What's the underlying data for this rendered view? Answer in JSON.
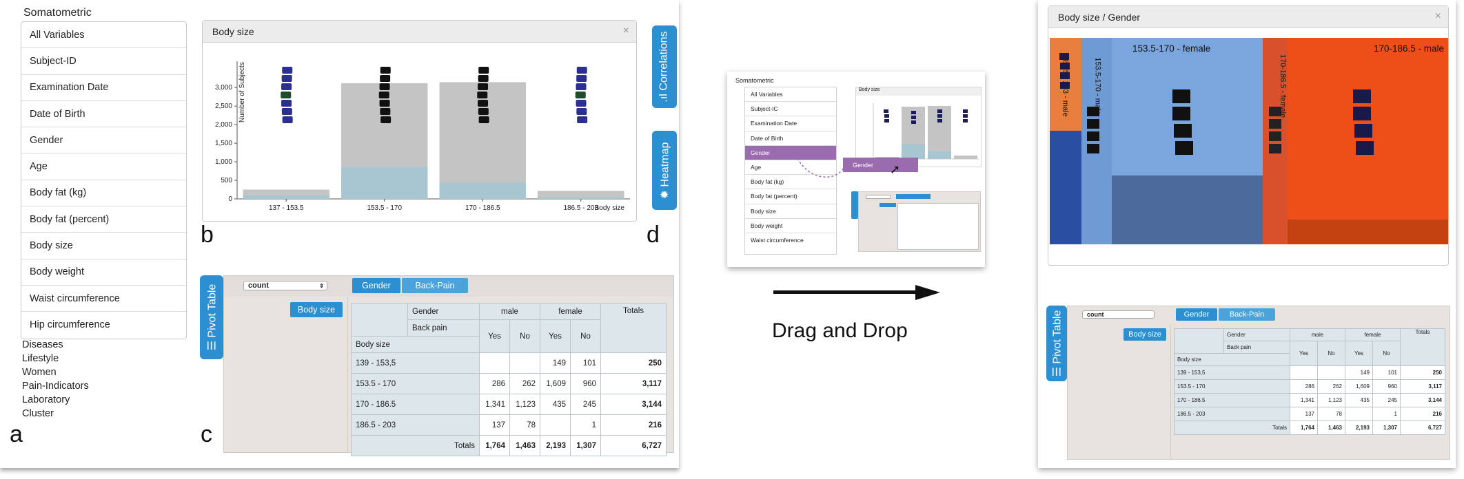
{
  "sidebar": {
    "title": "Somatometric",
    "items": [
      "All Variables",
      "Subject-ID",
      "Examination Date",
      "Date of Birth",
      "Gender",
      "Age",
      "Body fat (kg)",
      "Body fat (percent)",
      "Body size",
      "Body weight",
      "Waist circumference",
      "Hip circumference"
    ],
    "categories": [
      "Diseases",
      "Lifestyle",
      "Women",
      "Pain-Indicators",
      "Laboratory",
      "Cluster"
    ]
  },
  "letters": {
    "a": "a",
    "b": "b",
    "c": "c",
    "d": "d"
  },
  "chart_panel": {
    "title": "Body size",
    "close": "×"
  },
  "chart_data": {
    "type": "bar",
    "title": "Body size",
    "xlabel": "Body size",
    "ylabel": "Number of Subjects",
    "categories": [
      "137 - 153.5",
      "153.5 - 170",
      "170 - 186.5",
      "186.5 - 203"
    ],
    "values": [
      250,
      3117,
      3144,
      216
    ],
    "highlight_values": [
      100,
      860,
      440,
      40
    ],
    "yticks": [
      "0",
      "500",
      "1,000",
      "1,500",
      "2,000",
      "2,500",
      "3,000"
    ],
    "ylim": [
      0,
      3300
    ]
  },
  "side_tabs": {
    "correlations": "Correlations",
    "heatmap": "Heatmap",
    "pivot": "Pivot Table"
  },
  "pivot": {
    "select_value": "count",
    "column_vars": [
      "Gender",
      "Back-Pain"
    ],
    "row_var": "Body size",
    "header_gender": "Gender",
    "header_backpain": "Back pain",
    "male": "male",
    "female": "female",
    "totals_label": "Totals",
    "yes": "Yes",
    "no": "No",
    "body_size_label": "Body size",
    "rows": [
      {
        "label": "139 - 153,5",
        "cells": [
          "",
          "",
          "149",
          "101"
        ],
        "total": "250"
      },
      {
        "label": "153.5 - 170",
        "cells": [
          "286",
          "262",
          "1,609",
          "960"
        ],
        "total": "3,117"
      },
      {
        "label": "170 - 186.5",
        "cells": [
          "1,341",
          "1,123",
          "435",
          "245"
        ],
        "total": "3,144"
      },
      {
        "label": "186.5 - 203",
        "cells": [
          "137",
          "78",
          "",
          "1"
        ],
        "total": "216"
      }
    ],
    "totals_row": [
      "1,764",
      "1,463",
      "2,193",
      "1,307"
    ],
    "grand_total": "6,727"
  },
  "middle": {
    "caption": "Drag and Drop",
    "mini_title": "Somatometric",
    "mini_items": [
      "All Variables",
      "Subject-IC",
      "Examination Date",
      "Date of Birth",
      "Gender",
      "Age",
      "Body fat (kg)",
      "Body fat (percent)",
      "Body size",
      "Body weight",
      "Waist circumference"
    ],
    "mini_chart_title": "Body size",
    "drag_label": "Gender"
  },
  "result_panel": {
    "title": "Body size / Gender",
    "close": "×",
    "labels": [
      "153.5-170 - female",
      "170-186.5 - male",
      "186.5 - 203 - male",
      "153.5-170 - male",
      "170-186.5 - female"
    ],
    "pivot_rows": [
      {
        "label": "139 - 153,5",
        "cells": [
          "",
          "",
          "149",
          "101"
        ],
        "total": "250"
      },
      {
        "label": "153.5 - 170",
        "cells": [
          "286",
          "262",
          "1,609",
          "960"
        ],
        "total": "3,117"
      },
      {
        "label": "170 - 186.5",
        "cells": [
          "1,341",
          "1,123",
          "435",
          "245"
        ],
        "total": "3,144"
      },
      {
        "label": "186.5 - 203",
        "cells": [
          "137",
          "78",
          "",
          "1"
        ],
        "total": "216"
      }
    ]
  },
  "colors": {
    "accent": "#2b8fd1",
    "bar_gray": "#c4c4c4",
    "bar_highlight": "#a8c6d2",
    "drag_purple": "#9b6bb0"
  }
}
